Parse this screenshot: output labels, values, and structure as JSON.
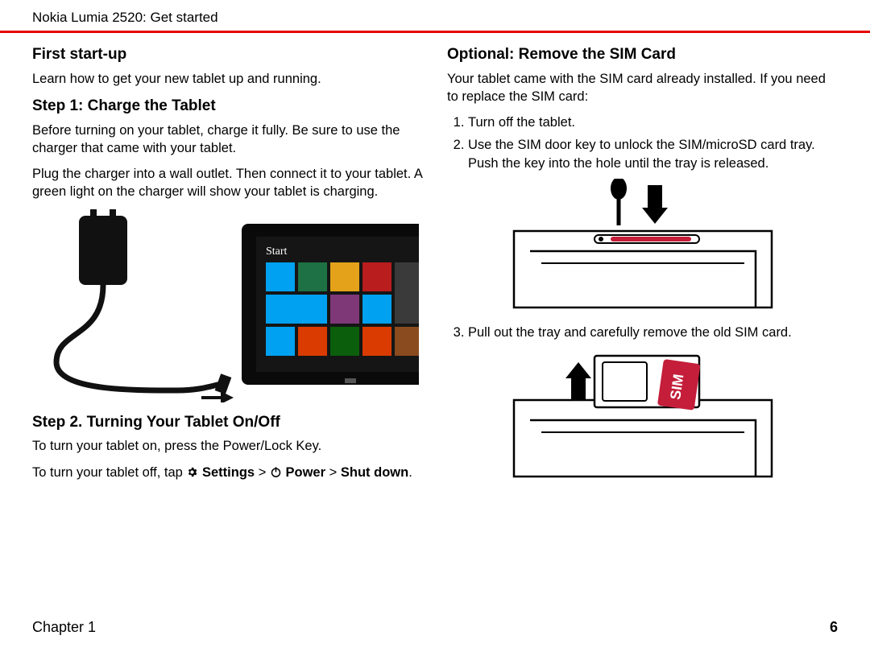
{
  "header": {
    "title": "Nokia Lumia 2520: Get started"
  },
  "left": {
    "h1": "First start-up",
    "p1": "Learn how to get your new tablet up and running.",
    "h2": "Step 1: Charge the Tablet",
    "p2": "Before turning on your tablet, charge it fully. Be sure to use the charger that came with your tablet.",
    "p3": "Plug the charger into a wall outlet. Then connect it to your tablet. A green light on the charger will show your tablet is charging.",
    "h3": "Step 2. Turning Your Tablet On/Off",
    "p4": "To turn your tablet on, press the Power/Lock Key.",
    "p5_prefix": "To turn your tablet off, tap ",
    "p5_settings": "Settings",
    "p5_sep": " > ",
    "p5_power": "Power",
    "p5_shutdown": "Shut down",
    "p5_suffix": "."
  },
  "right": {
    "h1": "Optional: Remove the SIM Card",
    "p1": "Your tablet came with the SIM card already installed. If you need to replace the SIM card:",
    "li1": "Turn off the tablet.",
    "li2": "Use the SIM door key to unlock the SIM/microSD card tray. Push the key into the hole until the tray is released.",
    "li3": "Pull out the tray and carefully remove the old SIM card."
  },
  "figure1_start_label": "Start",
  "sim_label": "SIM",
  "footer": {
    "chapter": "Chapter 1",
    "page": "6"
  }
}
